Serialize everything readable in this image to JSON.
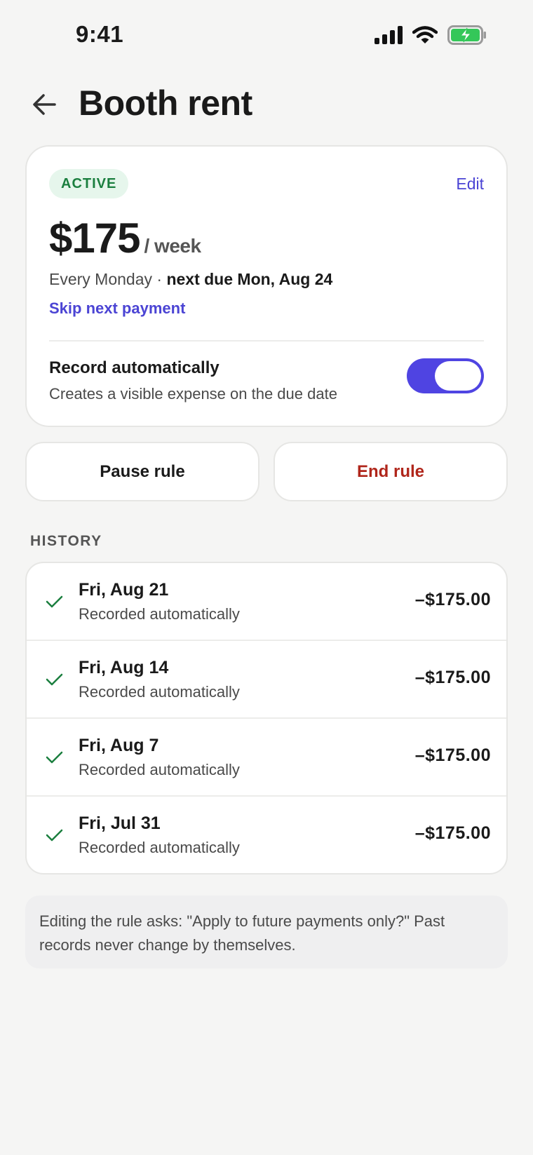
{
  "status_bar": {
    "time": "9:41",
    "icons": [
      "signal-icon",
      "wifi-icon",
      "battery-charging-icon"
    ]
  },
  "header": {
    "title": "Booth rent",
    "back_icon": "arrow-left-icon"
  },
  "rule": {
    "status_badge": "ACTIVE",
    "edit_label": "Edit",
    "amount": "$175",
    "period": "/ week",
    "schedule_prefix": "Every Monday · ",
    "next_due": "next due Mon, Aug 24",
    "skip_label": "Skip next payment",
    "auto_record": {
      "title": "Record automatically",
      "subtitle": "Creates a visible expense on the due date",
      "enabled": true
    }
  },
  "actions": {
    "pause_label": "Pause rule",
    "end_label": "End rule"
  },
  "history": {
    "label": "HISTORY",
    "items": [
      {
        "date": "Fri, Aug 21",
        "note": "Recorded automatically",
        "amount": "–$175.00"
      },
      {
        "date": "Fri, Aug 14",
        "note": "Recorded automatically",
        "amount": "–$175.00"
      },
      {
        "date": "Fri, Aug 7",
        "note": "Recorded automatically",
        "amount": "–$175.00"
      },
      {
        "date": "Fri, Jul 31",
        "note": "Recorded automatically",
        "amount": "–$175.00"
      }
    ]
  },
  "footer_note": "Editing the rule asks: \"Apply to future payments only?\" Past records never change by themselves.",
  "colors": {
    "accent": "#4f44e2",
    "link": "#4b44d4",
    "active_badge_bg": "#e6f6ec",
    "active_badge_text": "#1b7f3f",
    "danger": "#b0261b",
    "check": "#1b7f3f"
  }
}
